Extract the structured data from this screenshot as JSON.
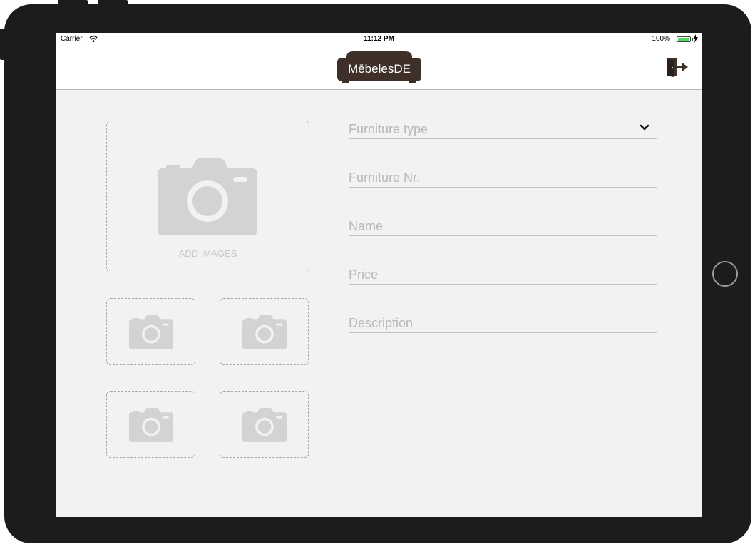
{
  "status_bar": {
    "carrier": "Carrier",
    "time": "11:12 PM",
    "battery": "100%",
    "battery_level": 1.0,
    "battery_color": "#4cd964"
  },
  "nav": {
    "logo_text": "MēbelesDE",
    "logo_color": "#3e3029",
    "logout_icon": "logout-door-icon"
  },
  "upload": {
    "main_label": "ADD IMAGES",
    "icon": "camera-icon",
    "thumbnail_slots": 4
  },
  "form": {
    "furniture_type_placeholder": "Furniture type",
    "furniture_nr_placeholder": "Furniture Nr.",
    "name_placeholder": "Name",
    "price_placeholder": "Price",
    "description_placeholder": "Description"
  },
  "colors": {
    "background": "#f2f2f2",
    "placeholder": "#b8b8b8",
    "icon_gray": "#d3d3d3",
    "bezel": "#1c1c1c"
  }
}
